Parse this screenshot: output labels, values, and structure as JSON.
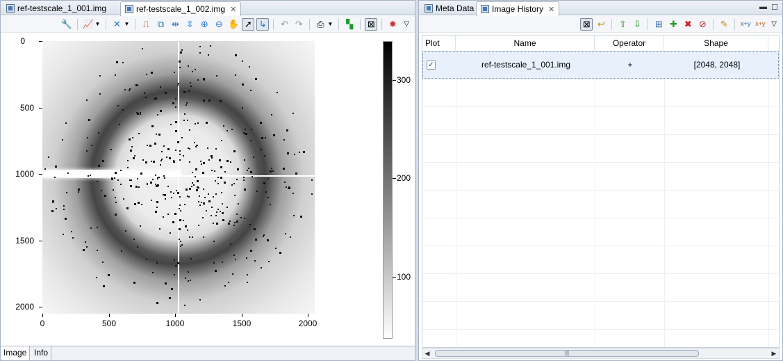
{
  "left_tabs": [
    {
      "label": "ref-testscale_1_001.img",
      "active": false
    },
    {
      "label": "ref-testscale_1_002.img",
      "active": true
    }
  ],
  "right_tabs": [
    {
      "label": "Meta Data",
      "active": false
    },
    {
      "label": "Image History",
      "active": true
    }
  ],
  "plot": {
    "y_ticks": [
      "0",
      "500",
      "1000",
      "1500",
      "2000"
    ],
    "x_ticks": [
      "0",
      "500",
      "1000",
      "1500",
      "2000"
    ],
    "colorbar_ticks": [
      "300",
      "200",
      "100"
    ]
  },
  "bottom_tabs": [
    "Image",
    "Info"
  ],
  "table": {
    "columns": [
      "Plot",
      "Name",
      "Operator",
      "Shape"
    ],
    "rows": [
      {
        "checked": true,
        "name": "ref-testscale_1_001.img",
        "operator": "+",
        "shape": "[2048, 2048]"
      }
    ]
  }
}
